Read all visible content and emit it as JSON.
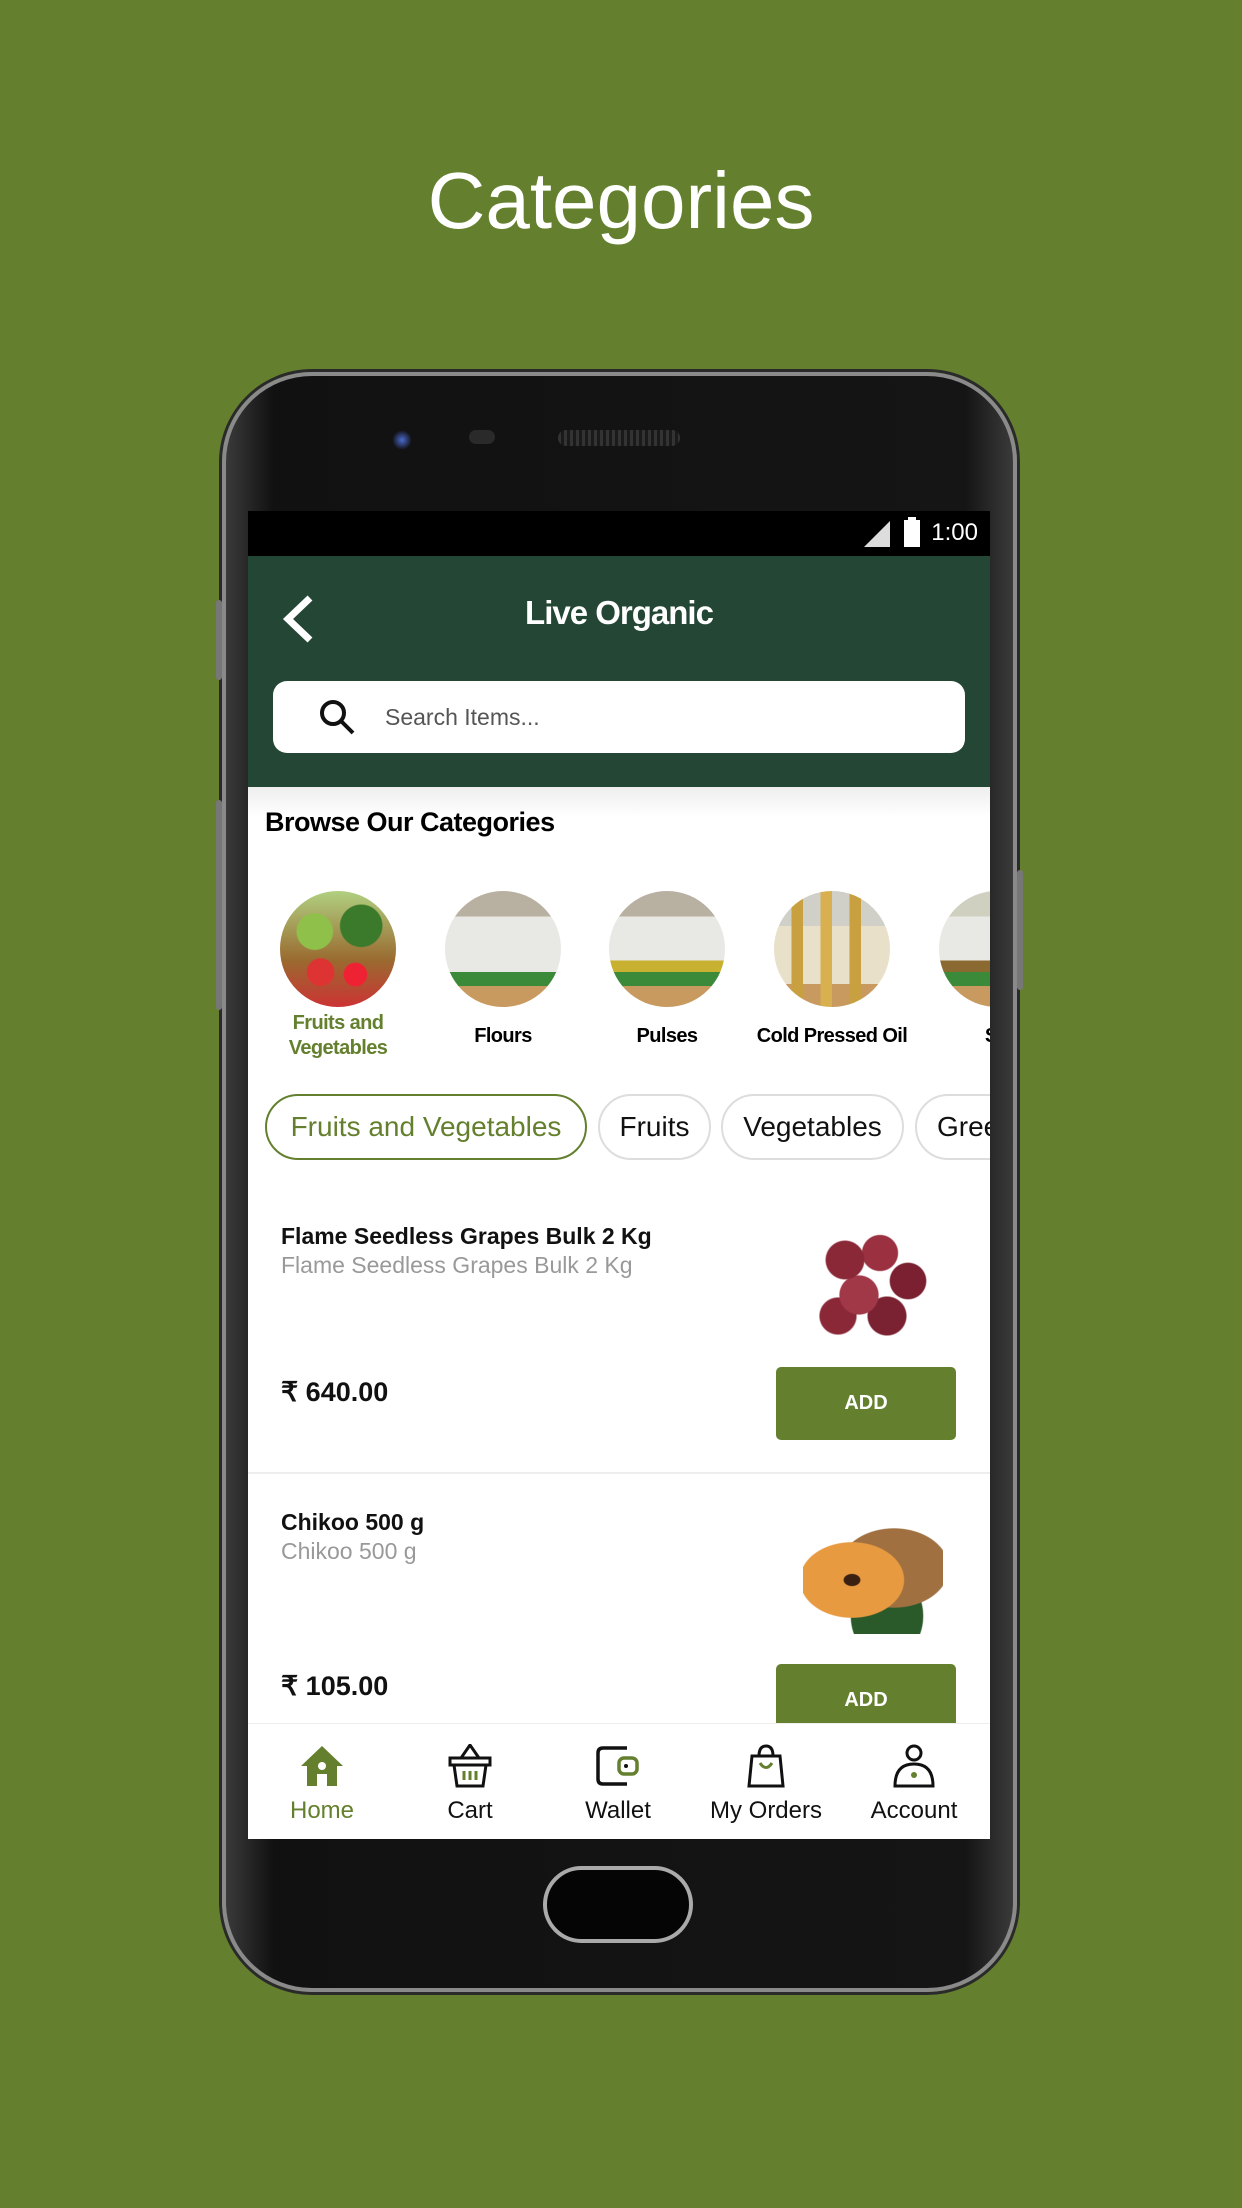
{
  "promo_title": "Categories",
  "status_bar": {
    "time": "1:00"
  },
  "header": {
    "title": "Live Organic",
    "search_placeholder": "Search Items..."
  },
  "categories_heading": "Browse Our Categories",
  "categories": [
    {
      "label": "Fruits and Vegetables",
      "active": true
    },
    {
      "label": "Flours"
    },
    {
      "label": "Pulses"
    },
    {
      "label": "Cold Pressed Oil"
    },
    {
      "label": "Sp"
    }
  ],
  "chips": [
    {
      "label": "Fruits and Vegetables",
      "active": true
    },
    {
      "label": "Fruits"
    },
    {
      "label": "Vegetables"
    },
    {
      "label": "Gree"
    }
  ],
  "products": [
    {
      "name": "Flame Seedless Grapes Bulk 2 Kg",
      "subtitle": "Flame Seedless Grapes Bulk 2 Kg",
      "price": "₹ 640.00",
      "button": "ADD"
    },
    {
      "name": "Chikoo 500 g",
      "subtitle": "Chikoo 500 g",
      "price": "₹ 105.00",
      "button": "ADD"
    }
  ],
  "nav": [
    {
      "label": "Home",
      "icon": "home-icon",
      "active": true
    },
    {
      "label": "Cart",
      "icon": "basket-icon"
    },
    {
      "label": "Wallet",
      "icon": "wallet-icon"
    },
    {
      "label": "My Orders",
      "icon": "shopping-bag-icon"
    },
    {
      "label": "Account",
      "icon": "user-icon"
    }
  ],
  "colors": {
    "background": "#64802e",
    "header": "#244634",
    "accent": "#64802e"
  }
}
